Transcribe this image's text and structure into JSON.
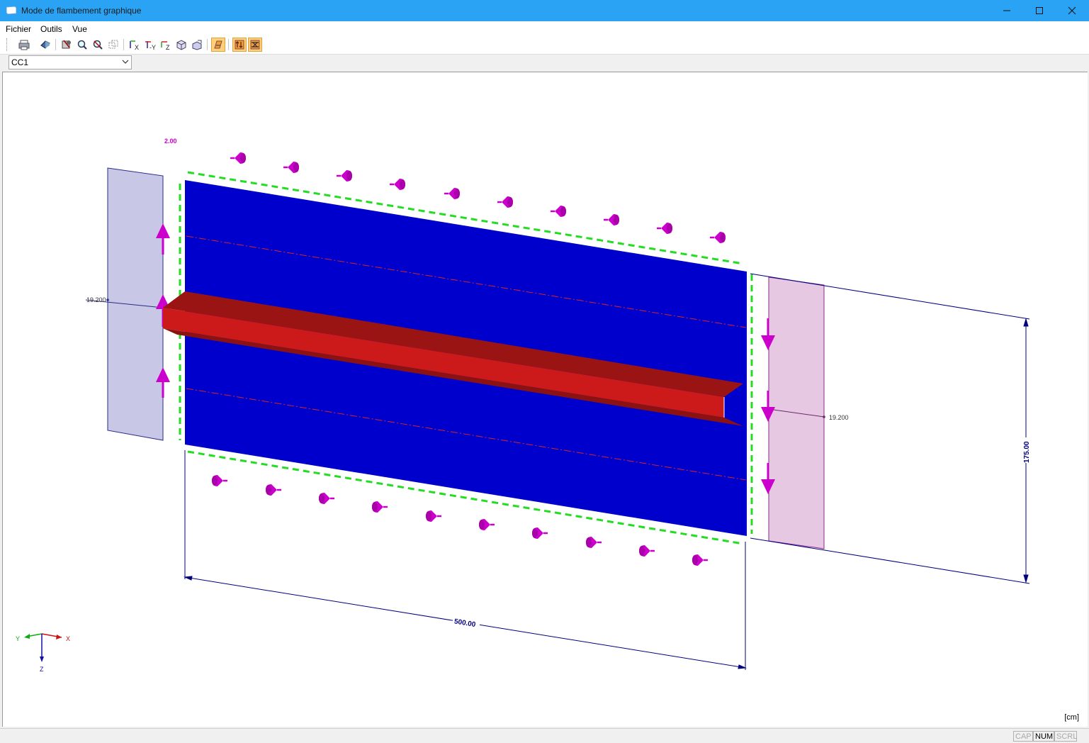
{
  "window": {
    "title": "Mode de flambement graphique"
  },
  "menu": {
    "items": [
      "Fichier",
      "Outils",
      "Vue"
    ]
  },
  "toolbar": {
    "buttons": [
      "print-icon",
      "export-icon",
      "select-all-icon",
      "zoom-icon",
      "zoom-reset-icon",
      "view-3d-icon",
      "view-x-icon",
      "view-y-icon",
      "view-z-icon",
      "view-iso-icon",
      "view-rotate-icon",
      "display-icon",
      "load-display-icon",
      "dimension-icon"
    ]
  },
  "load_case": {
    "selected": "CC1"
  },
  "graphic": {
    "load_value_label": "2.00",
    "left_stress_label": "19.200",
    "right_stress_label": "19.200",
    "length_dimension": "500.00",
    "height_dimension": "175.00",
    "units": "[cm]",
    "axes": {
      "x": "X",
      "y": "Y",
      "z": "Z"
    },
    "colors": {
      "plate": "#0000cc",
      "stiffener": "#cc1a1a",
      "support": "#22dd22",
      "load": "#cc00cc",
      "dimension": "#00007f"
    }
  },
  "status": {
    "cap": "CAP",
    "num": "NUM",
    "scrl": "SCRL"
  }
}
